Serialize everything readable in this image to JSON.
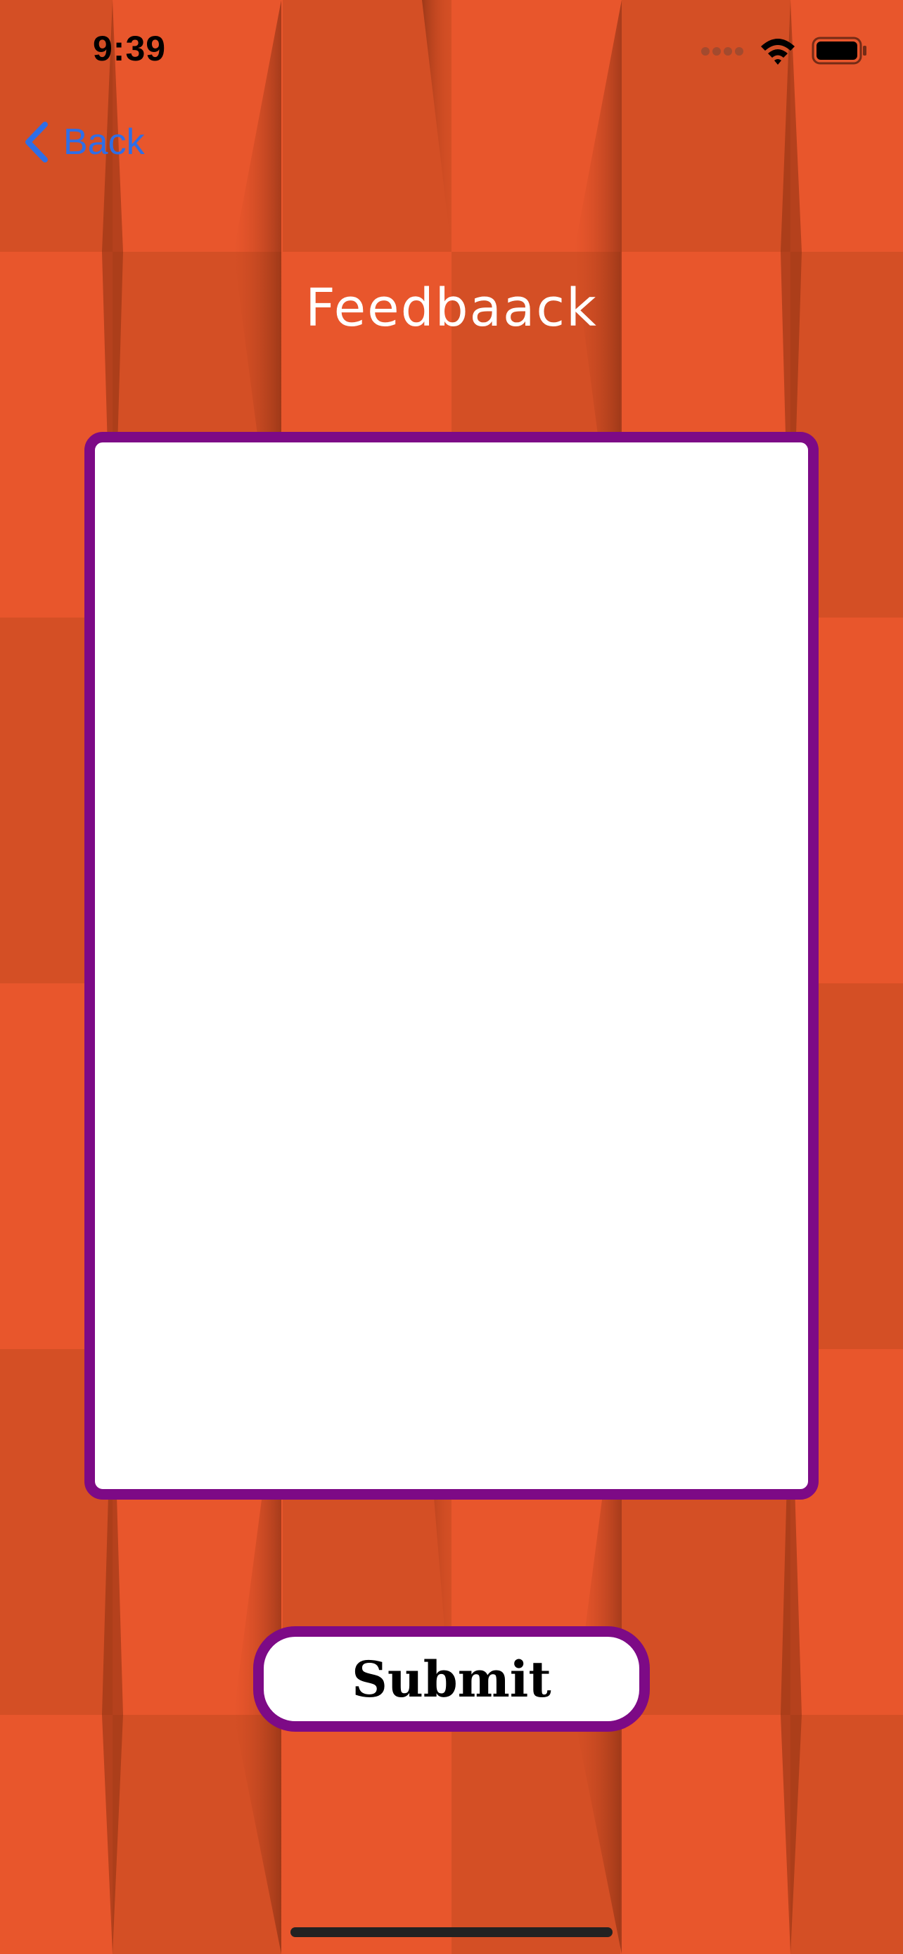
{
  "status_bar": {
    "time": "9:39",
    "signal_icon": "cellular-signal-icon",
    "wifi_icon": "wifi-icon",
    "battery_icon": "battery-icon"
  },
  "nav": {
    "back_label": "Back",
    "back_icon": "chevron-left-icon",
    "accent_color": "#2f6ee6"
  },
  "header": {
    "title": "Feedbaack"
  },
  "feedback": {
    "value": "",
    "border_color": "#7d0a86"
  },
  "actions": {
    "submit_label": "Submit"
  },
  "theme": {
    "background": "#e8562c",
    "background_dark": "#d44f25",
    "frame_color": "#7d0a86"
  }
}
